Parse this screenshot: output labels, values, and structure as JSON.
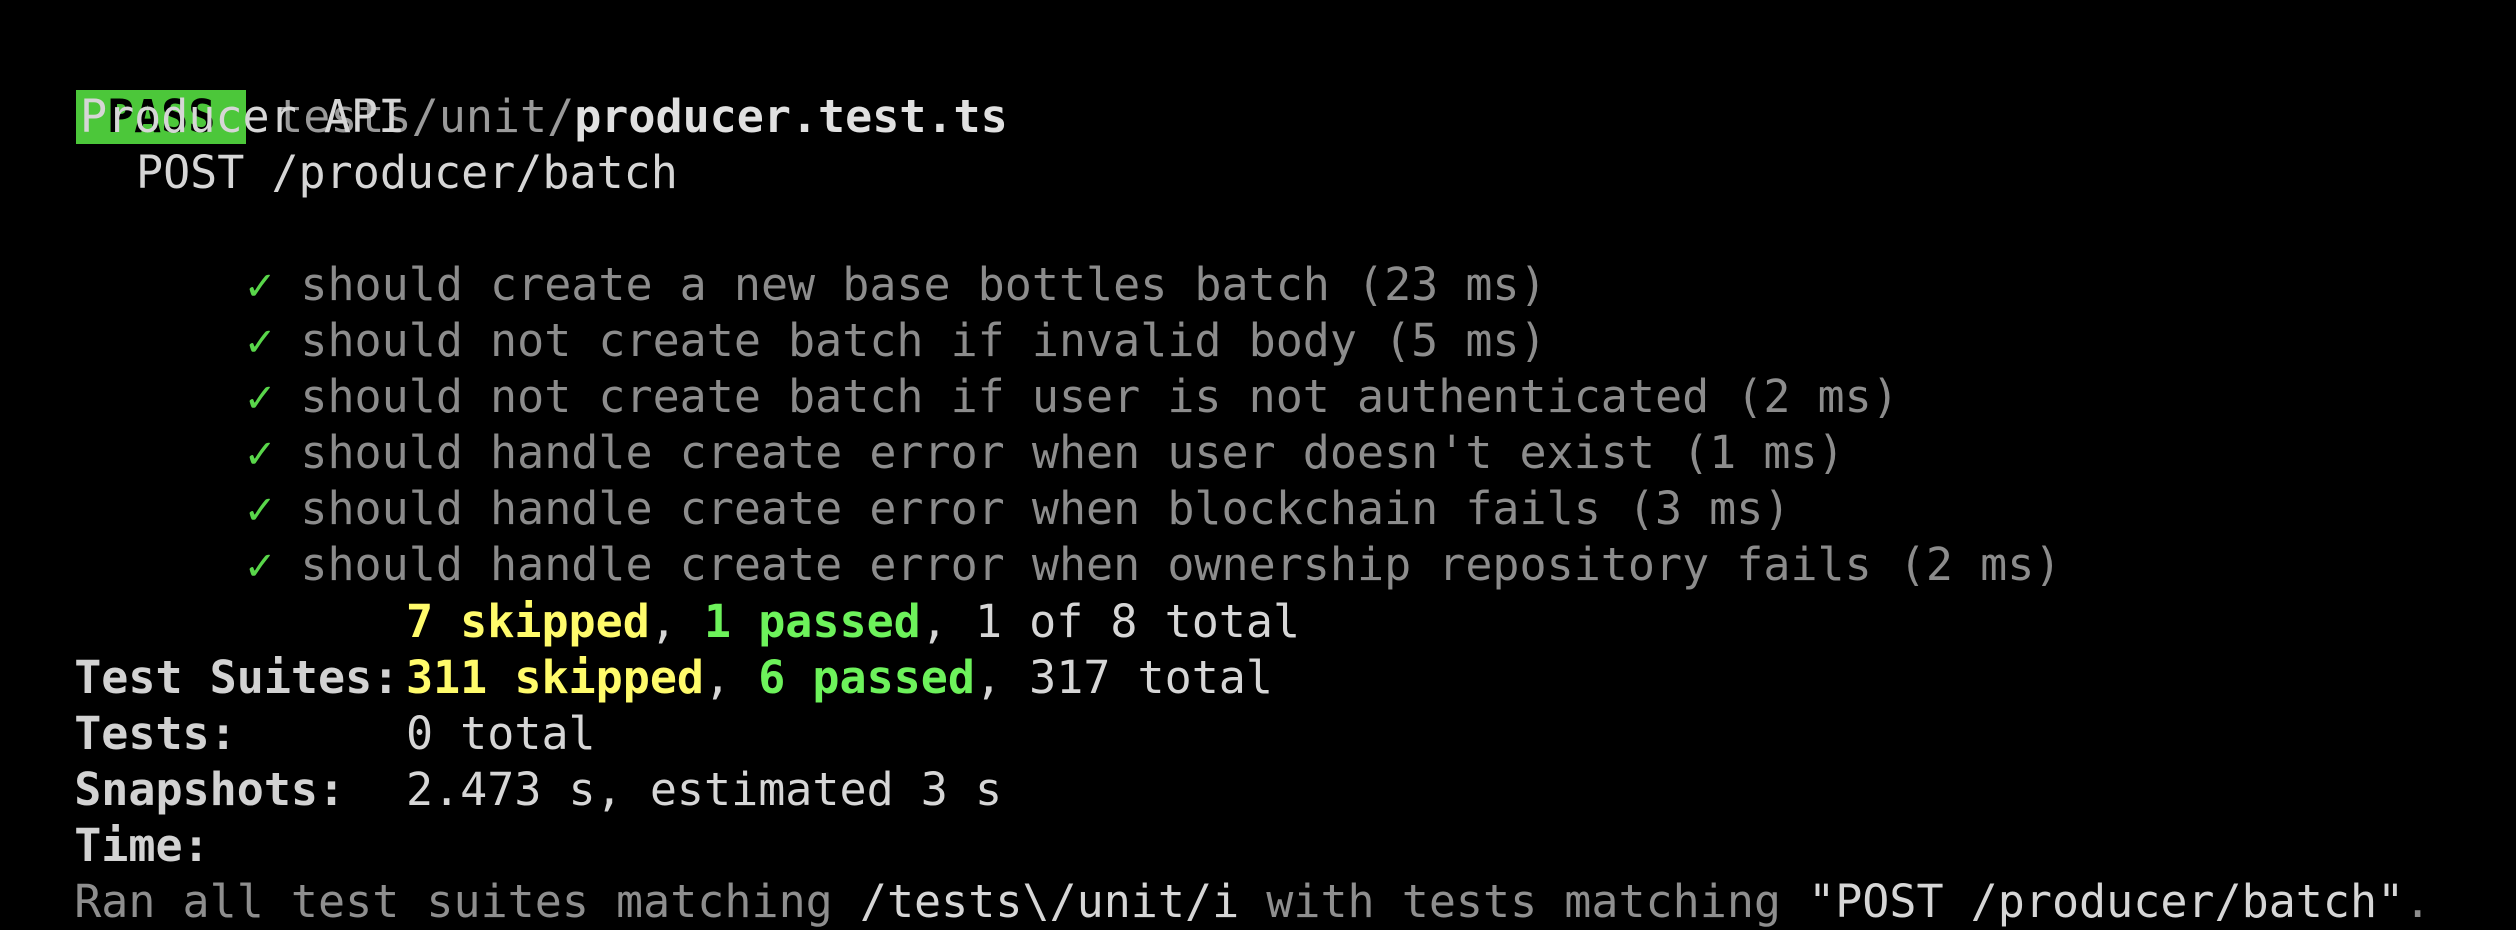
{
  "header": {
    "status": "PASS",
    "path_dir": "tests/unit/",
    "path_file": "producer.test.ts"
  },
  "suite": {
    "describe": "Producer API",
    "sub_describe": "POST /producer/batch",
    "tests": [
      {
        "check": "✓",
        "name": "should create a new base bottles batch (23 ms)"
      },
      {
        "check": "✓",
        "name": "should not create batch if invalid body (5 ms)"
      },
      {
        "check": "✓",
        "name": "should not create batch if user is not authenticated (2 ms)"
      },
      {
        "check": "✓",
        "name": "should handle create error when user doesn't exist (1 ms)"
      },
      {
        "check": "✓",
        "name": "should handle create error when blockchain fails (3 ms)"
      },
      {
        "check": "✓",
        "name": "should handle create error when ownership repository fails (2 ms)"
      }
    ]
  },
  "summary": {
    "suites": {
      "label": "Test Suites:",
      "skipped": "7 skipped",
      "sep1": ", ",
      "passed": "1 passed",
      "rest": ", 1 of 8 total"
    },
    "tests": {
      "label": "Tests:",
      "skipped": "311 skipped",
      "sep1": ", ",
      "passed": "6 passed",
      "rest": ", 317 total"
    },
    "snapshots": {
      "label": "Snapshots:",
      "value": "0 total"
    },
    "time": {
      "label": "Time:",
      "value": "2.473 s, estimated 3 s"
    },
    "ran": {
      "prefix": "Ran all test suites matching ",
      "pattern": "/tests\\/unit/i",
      "middle": " with tests matching ",
      "match": "\"POST /producer/batch\"",
      "suffix": "."
    }
  },
  "colors": {
    "background": "#000000",
    "pass_badge": "#4cc73a",
    "check": "#59d64a",
    "skipped": "#fffb6b",
    "passed": "#6df25b"
  }
}
